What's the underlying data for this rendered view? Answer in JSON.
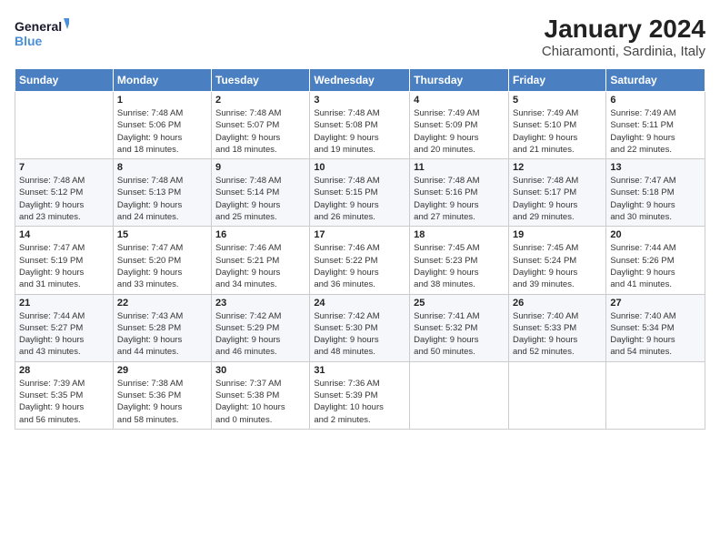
{
  "logo": {
    "text_general": "General",
    "text_blue": "Blue"
  },
  "title": "January 2024",
  "subtitle": "Chiaramonti, Sardinia, Italy",
  "weekdays": [
    "Sunday",
    "Monday",
    "Tuesday",
    "Wednesday",
    "Thursday",
    "Friday",
    "Saturday"
  ],
  "weeks": [
    [
      {
        "day": "",
        "info": ""
      },
      {
        "day": "1",
        "info": "Sunrise: 7:48 AM\nSunset: 5:06 PM\nDaylight: 9 hours\nand 18 minutes."
      },
      {
        "day": "2",
        "info": "Sunrise: 7:48 AM\nSunset: 5:07 PM\nDaylight: 9 hours\nand 18 minutes."
      },
      {
        "day": "3",
        "info": "Sunrise: 7:48 AM\nSunset: 5:08 PM\nDaylight: 9 hours\nand 19 minutes."
      },
      {
        "day": "4",
        "info": "Sunrise: 7:49 AM\nSunset: 5:09 PM\nDaylight: 9 hours\nand 20 minutes."
      },
      {
        "day": "5",
        "info": "Sunrise: 7:49 AM\nSunset: 5:10 PM\nDaylight: 9 hours\nand 21 minutes."
      },
      {
        "day": "6",
        "info": "Sunrise: 7:49 AM\nSunset: 5:11 PM\nDaylight: 9 hours\nand 22 minutes."
      }
    ],
    [
      {
        "day": "7",
        "info": "Sunrise: 7:48 AM\nSunset: 5:12 PM\nDaylight: 9 hours\nand 23 minutes."
      },
      {
        "day": "8",
        "info": "Sunrise: 7:48 AM\nSunset: 5:13 PM\nDaylight: 9 hours\nand 24 minutes."
      },
      {
        "day": "9",
        "info": "Sunrise: 7:48 AM\nSunset: 5:14 PM\nDaylight: 9 hours\nand 25 minutes."
      },
      {
        "day": "10",
        "info": "Sunrise: 7:48 AM\nSunset: 5:15 PM\nDaylight: 9 hours\nand 26 minutes."
      },
      {
        "day": "11",
        "info": "Sunrise: 7:48 AM\nSunset: 5:16 PM\nDaylight: 9 hours\nand 27 minutes."
      },
      {
        "day": "12",
        "info": "Sunrise: 7:48 AM\nSunset: 5:17 PM\nDaylight: 9 hours\nand 29 minutes."
      },
      {
        "day": "13",
        "info": "Sunrise: 7:47 AM\nSunset: 5:18 PM\nDaylight: 9 hours\nand 30 minutes."
      }
    ],
    [
      {
        "day": "14",
        "info": "Sunrise: 7:47 AM\nSunset: 5:19 PM\nDaylight: 9 hours\nand 31 minutes."
      },
      {
        "day": "15",
        "info": "Sunrise: 7:47 AM\nSunset: 5:20 PM\nDaylight: 9 hours\nand 33 minutes."
      },
      {
        "day": "16",
        "info": "Sunrise: 7:46 AM\nSunset: 5:21 PM\nDaylight: 9 hours\nand 34 minutes."
      },
      {
        "day": "17",
        "info": "Sunrise: 7:46 AM\nSunset: 5:22 PM\nDaylight: 9 hours\nand 36 minutes."
      },
      {
        "day": "18",
        "info": "Sunrise: 7:45 AM\nSunset: 5:23 PM\nDaylight: 9 hours\nand 38 minutes."
      },
      {
        "day": "19",
        "info": "Sunrise: 7:45 AM\nSunset: 5:24 PM\nDaylight: 9 hours\nand 39 minutes."
      },
      {
        "day": "20",
        "info": "Sunrise: 7:44 AM\nSunset: 5:26 PM\nDaylight: 9 hours\nand 41 minutes."
      }
    ],
    [
      {
        "day": "21",
        "info": "Sunrise: 7:44 AM\nSunset: 5:27 PM\nDaylight: 9 hours\nand 43 minutes."
      },
      {
        "day": "22",
        "info": "Sunrise: 7:43 AM\nSunset: 5:28 PM\nDaylight: 9 hours\nand 44 minutes."
      },
      {
        "day": "23",
        "info": "Sunrise: 7:42 AM\nSunset: 5:29 PM\nDaylight: 9 hours\nand 46 minutes."
      },
      {
        "day": "24",
        "info": "Sunrise: 7:42 AM\nSunset: 5:30 PM\nDaylight: 9 hours\nand 48 minutes."
      },
      {
        "day": "25",
        "info": "Sunrise: 7:41 AM\nSunset: 5:32 PM\nDaylight: 9 hours\nand 50 minutes."
      },
      {
        "day": "26",
        "info": "Sunrise: 7:40 AM\nSunset: 5:33 PM\nDaylight: 9 hours\nand 52 minutes."
      },
      {
        "day": "27",
        "info": "Sunrise: 7:40 AM\nSunset: 5:34 PM\nDaylight: 9 hours\nand 54 minutes."
      }
    ],
    [
      {
        "day": "28",
        "info": "Sunrise: 7:39 AM\nSunset: 5:35 PM\nDaylight: 9 hours\nand 56 minutes."
      },
      {
        "day": "29",
        "info": "Sunrise: 7:38 AM\nSunset: 5:36 PM\nDaylight: 9 hours\nand 58 minutes."
      },
      {
        "day": "30",
        "info": "Sunrise: 7:37 AM\nSunset: 5:38 PM\nDaylight: 10 hours\nand 0 minutes."
      },
      {
        "day": "31",
        "info": "Sunrise: 7:36 AM\nSunset: 5:39 PM\nDaylight: 10 hours\nand 2 minutes."
      },
      {
        "day": "",
        "info": ""
      },
      {
        "day": "",
        "info": ""
      },
      {
        "day": "",
        "info": ""
      }
    ]
  ]
}
